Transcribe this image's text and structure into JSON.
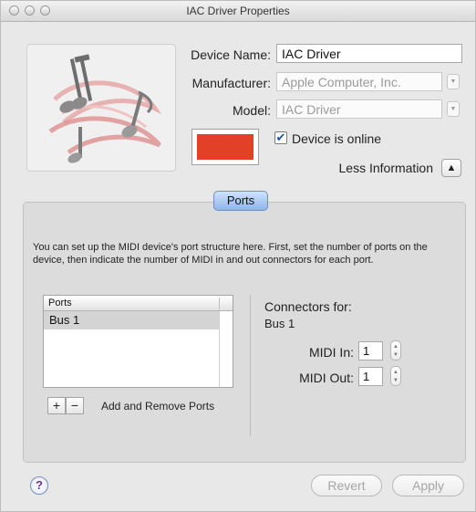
{
  "window": {
    "title": "IAC Driver Properties"
  },
  "device": {
    "name_label": "Device Name:",
    "name_value": "IAC Driver",
    "manufacturer_label": "Manufacturer:",
    "manufacturer_value": "Apple Computer, Inc.",
    "model_label": "Model:",
    "model_value": "IAC Driver",
    "online_label": "Device is online",
    "online_checked": true,
    "color": "#e34127",
    "less_info_label": "Less Information"
  },
  "tabs": {
    "ports_label": "Ports"
  },
  "ports": {
    "description": "You can set up the MIDI device's port structure here.  First, set the number of ports on the device, then indicate the number of MIDI in and out connectors for each port.",
    "list_header": "Ports",
    "items": [
      "Bus 1"
    ],
    "add_label": "+",
    "remove_label": "−",
    "add_remove_label": "Add and Remove Ports",
    "connectors_title": "Connectors for:",
    "connectors_port": "Bus 1",
    "midi_in_label": "MIDI In:",
    "midi_in_value": "1",
    "midi_out_label": "MIDI Out:",
    "midi_out_value": "1"
  },
  "footer": {
    "help_label": "?",
    "revert_label": "Revert",
    "apply_label": "Apply"
  },
  "colors": {
    "accent_tab": "#8fb6ea",
    "help_mark": "#6b2f8f"
  }
}
